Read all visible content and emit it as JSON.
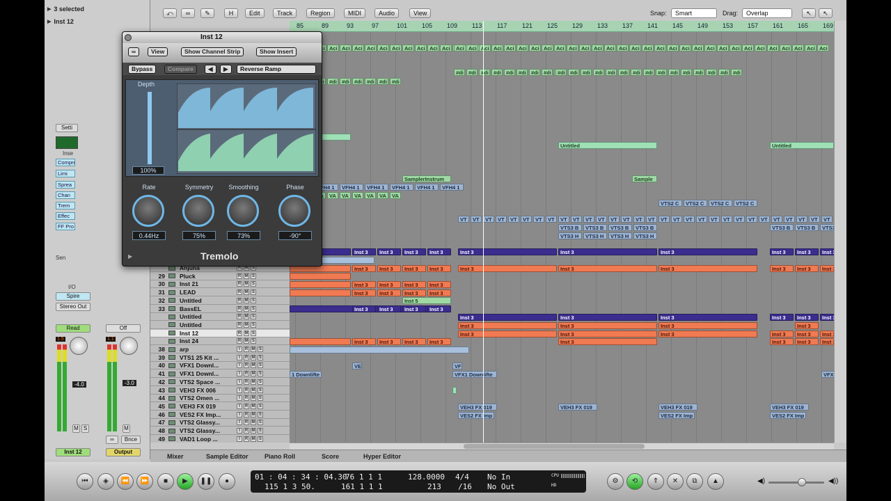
{
  "inspector": {
    "rows": [
      "3 selected",
      "Inst 12"
    ],
    "setti_label": "Setti",
    "inse_label": "Inse",
    "plugins": [
      "Compre",
      "Limi",
      "Sprea",
      "Chan",
      "Trem",
      "Effec",
      "FF Pro"
    ],
    "send_label": "Sen",
    "io_label": "I/O",
    "input": "Spire",
    "output": "Stereo Out",
    "read_label": "Read",
    "off_label": "Off",
    "vol_left": "-4.0",
    "vol_right": "-3.0",
    "peak_left": "1.5",
    "peak_right": "1.1",
    "m_label": "M",
    "s_label": "S",
    "bnce_label": "Bnce",
    "name_left": "Inst 12",
    "name_right": "Output"
  },
  "toolbar": {
    "menus": [
      "Edit",
      "Track",
      "Region",
      "MIDI",
      "Audio",
      "View"
    ],
    "h_label": "H",
    "snap_label": "Snap:",
    "snap_value": "Smart",
    "drag_label": "Drag:",
    "drag_value": "Overlap"
  },
  "ruler": [
    "85",
    "89",
    "93",
    "97",
    "101",
    "105",
    "109",
    "113",
    "117",
    "121",
    "125",
    "129",
    "133",
    "137",
    "141",
    "145",
    "149",
    "153",
    "157",
    "161",
    "165",
    "169"
  ],
  "plugin": {
    "title": "Inst 12",
    "view": "View",
    "show_channel_strip": "Show Channel Strip",
    "show_insert": "Show Insert",
    "bypass": "Bypass",
    "compare": "Compare",
    "preset": "Reverse Ramp",
    "depth_label": "Depth",
    "depth_value": "100%",
    "rate_label": "Rate",
    "rate_value": "0.44Hz",
    "symmetry_label": "Symmetry",
    "symmetry_value": "75%",
    "smoothing_label": "Smoothing",
    "smoothing_value": "73%",
    "phase_label": "Phase",
    "phase_value": "-90°",
    "name": "Tremolo"
  },
  "tracks": [
    {
      "num": "",
      "name": "Anjuna"
    },
    {
      "num": "29",
      "name": "Pluck"
    },
    {
      "num": "30",
      "name": "Inst 21"
    },
    {
      "num": "31",
      "name": "LEAD"
    },
    {
      "num": "32",
      "name": "Untitled"
    },
    {
      "num": "33",
      "name": "BassEL"
    },
    {
      "num": "",
      "name": "Untitled"
    },
    {
      "num": "",
      "name": "Untitled"
    },
    {
      "num": "",
      "name": "Inst 12"
    },
    {
      "num": "",
      "name": "Inst 24"
    },
    {
      "num": "38",
      "name": "arp"
    },
    {
      "num": "39",
      "name": "VTS1 25 Kit ..."
    },
    {
      "num": "40",
      "name": "VFX1 Downl..."
    },
    {
      "num": "41",
      "name": "VFX1 Downl..."
    },
    {
      "num": "42",
      "name": "VTS2 Space ..."
    },
    {
      "num": "43",
      "name": "VEH3 FX 006"
    },
    {
      "num": "44",
      "name": "VTS2 Omen ..."
    },
    {
      "num": "45",
      "name": "VEH3 FX 019"
    },
    {
      "num": "46",
      "name": "VES2 FX Imp..."
    },
    {
      "num": "47",
      "name": "VTS2 Glassy..."
    },
    {
      "num": "48",
      "name": "VTS2 Glassy..."
    },
    {
      "num": "49",
      "name": "VAD1 Loop ..."
    }
  ],
  "track_buttons": {
    "r": "R",
    "m": "M",
    "s": "S",
    "i": "I"
  },
  "regions": {
    "acid": "Aci",
    "di": "#di",
    "untitled": "Untitled",
    "sampler_instrum": "SamplerInstrum",
    "sample": "Sample",
    "vfh": "VFH4 1",
    "va": "VA",
    "vts2c": "VTS2 C",
    "vt": "VT",
    "vts3b": "VTS3 B",
    "vts3h": "VTS3 H",
    "inst3": "Inst 3",
    "inst5": "Inst 5",
    "ve": "VE",
    "downlift": "1 Downlifte",
    "vfx1_downlift": "VFX1 Downlifte",
    "vf": "VF",
    "veh3": "VEH3 FX 019",
    "ves2": "VES2 FX Imp",
    "vfx_short": "VFX"
  },
  "bottom_tabs": [
    "Mixer",
    "Sample Editor",
    "Piano Roll",
    "Score",
    "Hyper Editor"
  ],
  "transport": {
    "time_top": "01 : 04 : 34 : 04.30",
    "time_bottom": "115   1   3   50.",
    "bar_top": "76   1   1   1",
    "bar_bottom": "161   1   1   1",
    "tempo_top": "128.0000",
    "tempo_bottom": "213",
    "sig_top": "4/4",
    "sig_bottom": "/16",
    "in_label": "No In",
    "out_label": "No Out",
    "cpu_label": "CPU",
    "hd_label": "HD"
  }
}
